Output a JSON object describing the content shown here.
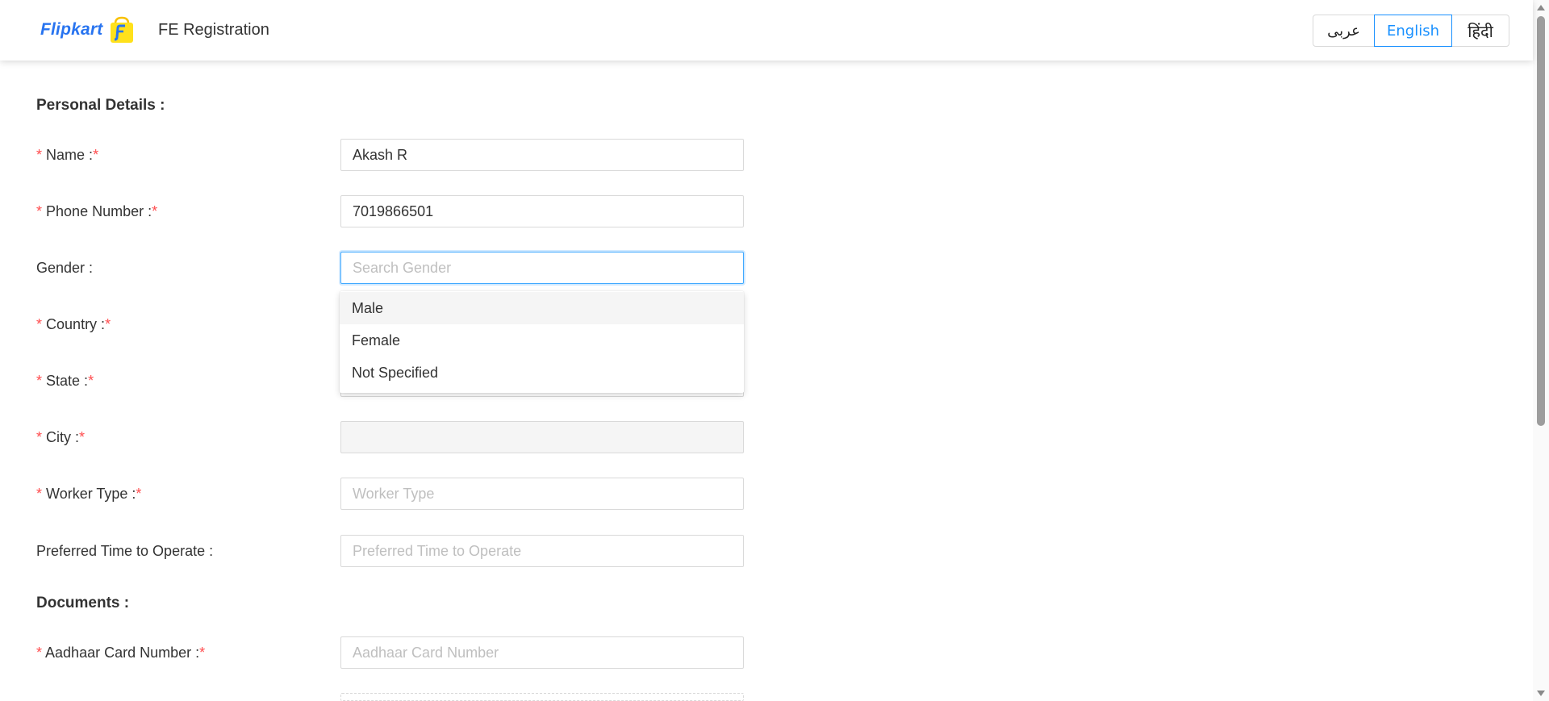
{
  "header": {
    "logo_text": "Flipkart",
    "title": "FE Registration",
    "languages": [
      "عربى",
      "English",
      "हिंदी"
    ],
    "active_language": "English",
    "accent_color": "#1890ff",
    "brand_color": "#2874f0"
  },
  "sections": {
    "personal": "Personal Details :",
    "documents": "Documents :"
  },
  "required_mark": "*",
  "fields": {
    "name": {
      "label": "Name :",
      "value": "Akash R",
      "placeholder": ""
    },
    "phone": {
      "label": "Phone Number :",
      "value": "7019866501",
      "placeholder": ""
    },
    "gender": {
      "label": "Gender :",
      "value": "",
      "placeholder": "Search Gender"
    },
    "country": {
      "label": "Country :"
    },
    "state": {
      "label": "State :"
    },
    "city": {
      "label": "City :",
      "value": ""
    },
    "worker_type": {
      "label": "Worker Type :",
      "value": "",
      "placeholder": "Worker Type"
    },
    "preferred_time": {
      "label": "Preferred Time to Operate :",
      "value": "",
      "placeholder": "Preferred Time to Operate"
    },
    "aadhaar": {
      "label": "Aadhaar Card Number :",
      "value": "",
      "placeholder": "Aadhaar Card Number"
    }
  },
  "gender_dropdown": {
    "options": [
      "Male",
      "Female",
      "Not Specified"
    ],
    "highlighted": "Male"
  },
  "icons": {
    "logo": "flipkart-bag-icon",
    "scroll_up": "scroll-up-arrow-icon",
    "scroll_down": "scroll-down-arrow-icon"
  }
}
